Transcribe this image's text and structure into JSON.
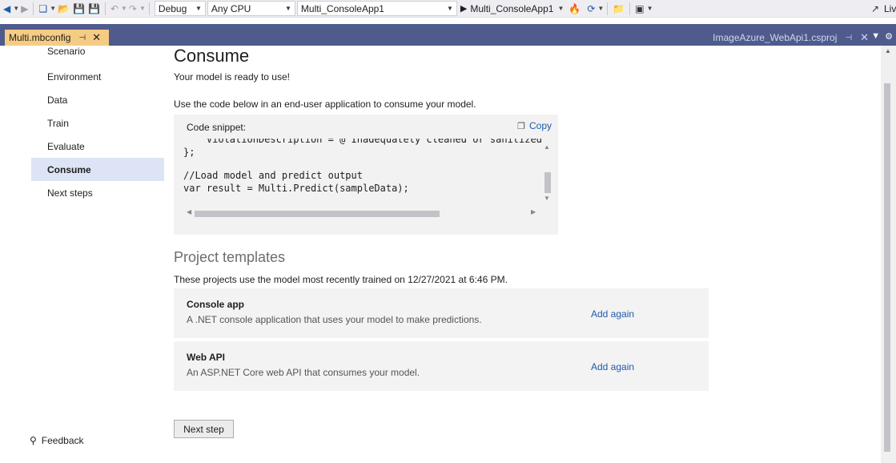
{
  "toolbar": {
    "config": "Debug",
    "platform": "Any CPU",
    "startup_project": "Multi_ConsoleApp1",
    "run_label": "Multi_ConsoleApp1",
    "live_label": "Liv"
  },
  "tabs": {
    "active": "Multi.mbconfig",
    "other": "ImageAzure_WebApi1.csproj"
  },
  "nav": {
    "items": [
      {
        "label": "Scenario"
      },
      {
        "label": "Environment"
      },
      {
        "label": "Data"
      },
      {
        "label": "Train"
      },
      {
        "label": "Evaluate"
      },
      {
        "label": "Consume"
      },
      {
        "label": "Next steps"
      }
    ],
    "active_index": 5,
    "feedback": "Feedback"
  },
  "main": {
    "title": "Consume",
    "ready_text": "Your model is ready to use!",
    "instructions": "Use the code below in an end-user application to consume your model.",
    "snippet_label": "Code snippet:",
    "copy_label": "Copy",
    "code_lines": [
      "    ViolationDescription = @\"Inadequately cleaned or sanitized f",
      "};",
      "",
      "//Load model and predict output",
      "var result = Multi.Predict(sampleData);"
    ],
    "templates_title": "Project templates",
    "templates_desc": "These projects use the model most recently trained on 12/27/2021 at 6:46 PM.",
    "templates": [
      {
        "name": "Console app",
        "description": "A .NET console application that uses your model to make predictions.",
        "action": "Add again"
      },
      {
        "name": "Web API",
        "description": "An ASP.NET Core web API that consumes your model.",
        "action": "Add again"
      }
    ],
    "next_button": "Next step"
  },
  "colors": {
    "accent_link": "#1e5bab",
    "tab_bar": "#4f5b8d",
    "active_tab": "#f5cc84",
    "nav_active": "#dde4f5"
  }
}
